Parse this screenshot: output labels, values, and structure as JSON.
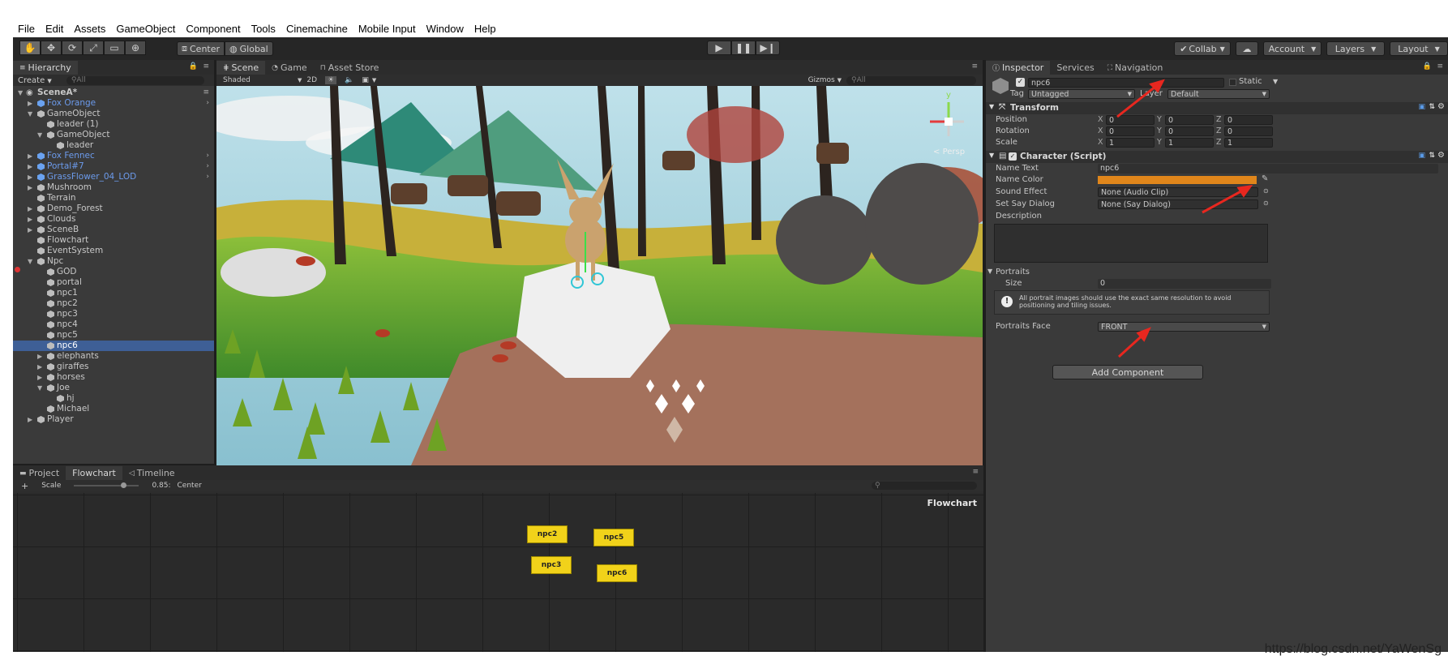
{
  "menu": [
    "File",
    "Edit",
    "Assets",
    "GameObject",
    "Component",
    "Tools",
    "Cinemachine",
    "Mobile Input",
    "Window",
    "Help"
  ],
  "toolbar": {
    "pivot_center": "Center",
    "pivot_global": "Global",
    "collab": "Collab",
    "account": "Account",
    "layers": "Layers",
    "layout": "Layout"
  },
  "hierarchy": {
    "tab": "Hierarchy",
    "create": "Create",
    "search_placeholder": "All",
    "items": [
      {
        "label": "SceneA*",
        "depth": 0,
        "expanded": true,
        "scene": true
      },
      {
        "label": "Fox Orange",
        "depth": 1,
        "prefab": true,
        "has_children": true,
        "more": true
      },
      {
        "label": "GameObject",
        "depth": 1,
        "expanded": true
      },
      {
        "label": "leader (1)",
        "depth": 2
      },
      {
        "label": "GameObject",
        "depth": 2,
        "expanded": true
      },
      {
        "label": "leader",
        "depth": 3
      },
      {
        "label": "Fox Fennec",
        "depth": 1,
        "prefab": true,
        "has_children": true,
        "more": true
      },
      {
        "label": "Portal#7",
        "depth": 1,
        "prefab": true,
        "has_children": true,
        "more": true
      },
      {
        "label": "GrassFlower_04_LOD",
        "depth": 1,
        "prefab": true,
        "has_children": true,
        "more": true
      },
      {
        "label": "Mushroom",
        "depth": 1,
        "has_children": true
      },
      {
        "label": "Terrain",
        "depth": 1
      },
      {
        "label": "Demo_Forest",
        "depth": 1,
        "has_children": true
      },
      {
        "label": "Clouds",
        "depth": 1,
        "has_children": true
      },
      {
        "label": "SceneB",
        "depth": 1,
        "has_children": true
      },
      {
        "label": "Flowchart",
        "depth": 1
      },
      {
        "label": "EventSystem",
        "depth": 1
      },
      {
        "label": "Npc",
        "depth": 1,
        "expanded": true
      },
      {
        "label": "GOD",
        "depth": 2
      },
      {
        "label": "portal",
        "depth": 2
      },
      {
        "label": "npc1",
        "depth": 2
      },
      {
        "label": "npc2",
        "depth": 2
      },
      {
        "label": "npc3",
        "depth": 2
      },
      {
        "label": "npc4",
        "depth": 2
      },
      {
        "label": "npc5",
        "depth": 2
      },
      {
        "label": "npc6",
        "depth": 2,
        "selected": true
      },
      {
        "label": "elephants",
        "depth": 2,
        "has_children": true
      },
      {
        "label": "giraffes",
        "depth": 2,
        "has_children": true
      },
      {
        "label": "horses",
        "depth": 2,
        "has_children": true
      },
      {
        "label": "Joe",
        "depth": 2,
        "expanded": true
      },
      {
        "label": "hj",
        "depth": 3
      },
      {
        "label": "Michael",
        "depth": 2
      },
      {
        "label": "Player",
        "depth": 1,
        "has_children": true
      }
    ]
  },
  "scene": {
    "tabs": [
      "Scene",
      "Game",
      "Asset Store"
    ],
    "shading": "Shaded",
    "mode_2d": "2D",
    "gizmos": "Gizmos",
    "search_placeholder": "All",
    "persp": "Persp",
    "gizmo_y": "y"
  },
  "bottom": {
    "tabs": [
      "Project",
      "Flowchart",
      "Timeline"
    ],
    "scale_label": "Scale",
    "scale_value": "0.85:",
    "center": "Center",
    "flowchart_title": "Flowchart",
    "nodes": [
      "npc2",
      "npc5",
      "npc3",
      "npc6"
    ]
  },
  "inspector": {
    "tabs": [
      "Inspector",
      "Services",
      "Navigation"
    ],
    "object_name": "npc6",
    "static_label": "Static",
    "tag_label": "Tag",
    "tag_value": "Untagged",
    "layer_label": "Layer",
    "layer_value": "Default",
    "transform": {
      "title": "Transform",
      "rows": [
        {
          "label": "Position",
          "x": "0",
          "y": "0",
          "z": "0"
        },
        {
          "label": "Rotation",
          "x": "0",
          "y": "0",
          "z": "0"
        },
        {
          "label": "Scale",
          "x": "1",
          "y": "1",
          "z": "1"
        }
      ]
    },
    "character": {
      "title": "Character (Script)",
      "name_text_label": "Name Text",
      "name_text_value": "npc6",
      "name_color_label": "Name Color",
      "name_color": "#e0861b",
      "sound_effect_label": "Sound Effect",
      "sound_effect_value": "None (Audio Clip)",
      "say_dialog_label": "Set Say Dialog",
      "say_dialog_value": "None (Say Dialog)",
      "description_label": "Description",
      "portraits_label": "Portraits",
      "size_label": "Size",
      "size_value": "0",
      "help_text": "All portrait images should use the exact same resolution to avoid positioning and tiling issues.",
      "portraits_face_label": "Portraits Face",
      "portraits_face_value": "FRONT"
    },
    "add_component": "Add Component"
  },
  "watermark": "https://blog.csdn.net/YaWenSg",
  "colors": {
    "selection": "#3e5f96",
    "prefab_text": "#6c9bec",
    "node_yellow": "#f1d21a",
    "annotation_red": "#e8271f"
  }
}
